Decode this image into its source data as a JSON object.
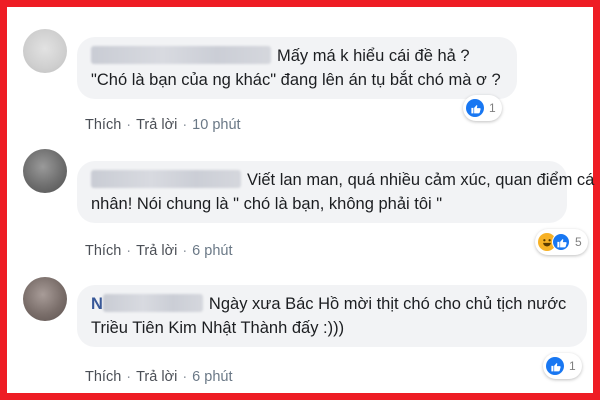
{
  "colors": {
    "frame": "#ee1c24",
    "bubble": "#f2f3f5",
    "like": "#1877f2",
    "haha": "#f7b125"
  },
  "comments": [
    {
      "name_initial": "",
      "lines": [
        "Mấy má k hiểu cái đề hả ?",
        "\"Chó là bạn của ng khác\" đang lên án tụ bắt chó mà ơ ?"
      ],
      "actions": {
        "like": "Thích",
        "reply": "Trả lời",
        "time": "10 phút"
      },
      "reaction": {
        "icons": [
          "like-icon"
        ],
        "count": "1"
      }
    },
    {
      "name_initial": "",
      "lines": [
        "Viết lan man, quá nhiều cảm xúc, quan điểm cá",
        "nhân! Nói chung là \" chó là bạn, không phải tôi \""
      ],
      "actions": {
        "like": "Thích",
        "reply": "Trả lời",
        "time": "6 phút"
      },
      "reaction": {
        "icons": [
          "haha-icon",
          "like-icon"
        ],
        "count": "5"
      }
    },
    {
      "name_initial": "N",
      "lines": [
        "Ngày xưa Bác Hồ mời thịt chó cho chủ tịch nước",
        "Triều Tiên Kim Nhật Thành đấy :)))"
      ],
      "actions": {
        "like": "Thích",
        "reply": "Trả lời",
        "time": "6 phút"
      },
      "reaction": {
        "icons": [
          "like-icon"
        ],
        "count": "1"
      }
    }
  ]
}
